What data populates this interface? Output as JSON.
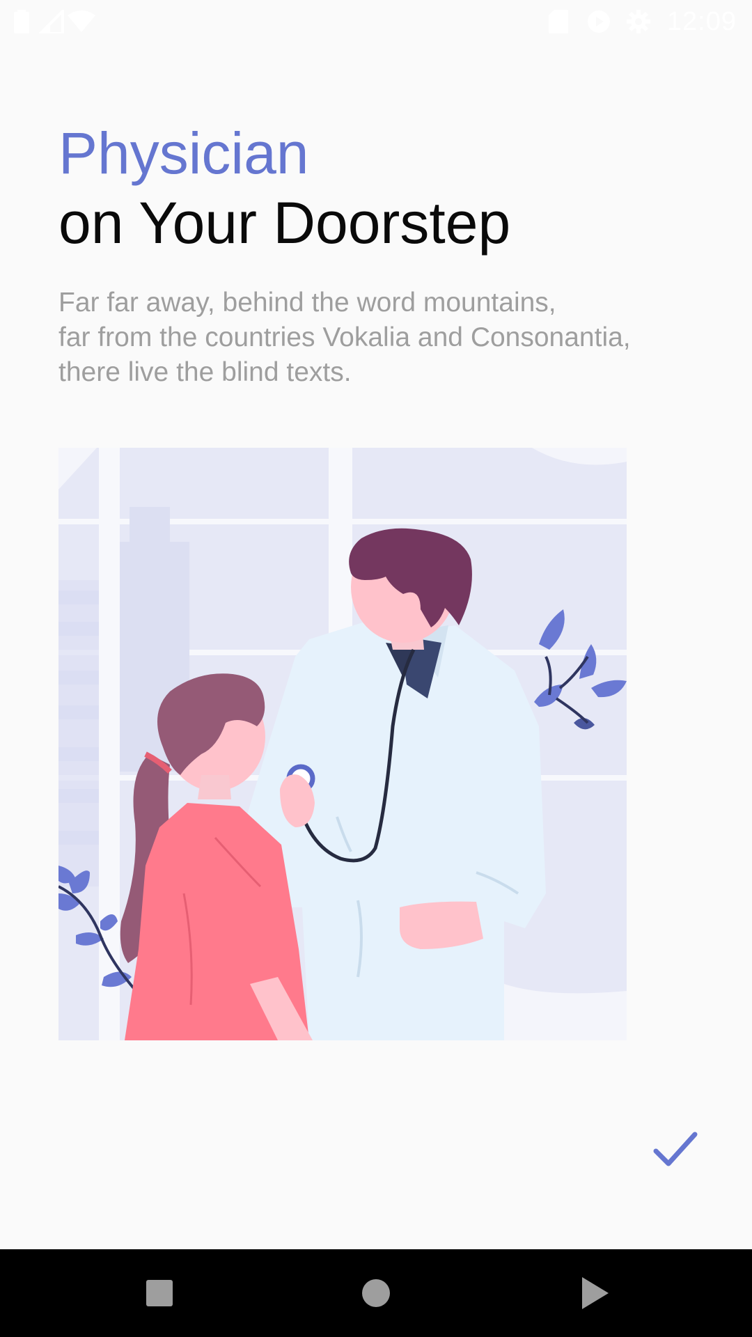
{
  "status_bar": {
    "time": "12:09",
    "left_icons": [
      "battery-icon",
      "signal-icon",
      "wifi-icon"
    ],
    "right_icons": [
      "sd-card-icon",
      "play-store-icon",
      "settings-icon"
    ]
  },
  "headline": {
    "accent": "Physician",
    "main": "on Your Doorstep"
  },
  "description": {
    "lines": [
      "Far far away, behind the word mountains,",
      "far from the countries Vokalia and Consonantia,",
      "there live the blind texts."
    ]
  },
  "illustration": {
    "icon": "doctor-patient-illustration"
  },
  "actions": {
    "done_icon": "check-icon"
  },
  "navigation_bar": {
    "buttons": [
      "recent-apps-icon",
      "home-icon",
      "back-icon"
    ]
  },
  "colors": {
    "accent": "#6576d0",
    "background": "#fafafa",
    "headline": "#0a0a0a",
    "body_text": "#9e9e9e"
  }
}
